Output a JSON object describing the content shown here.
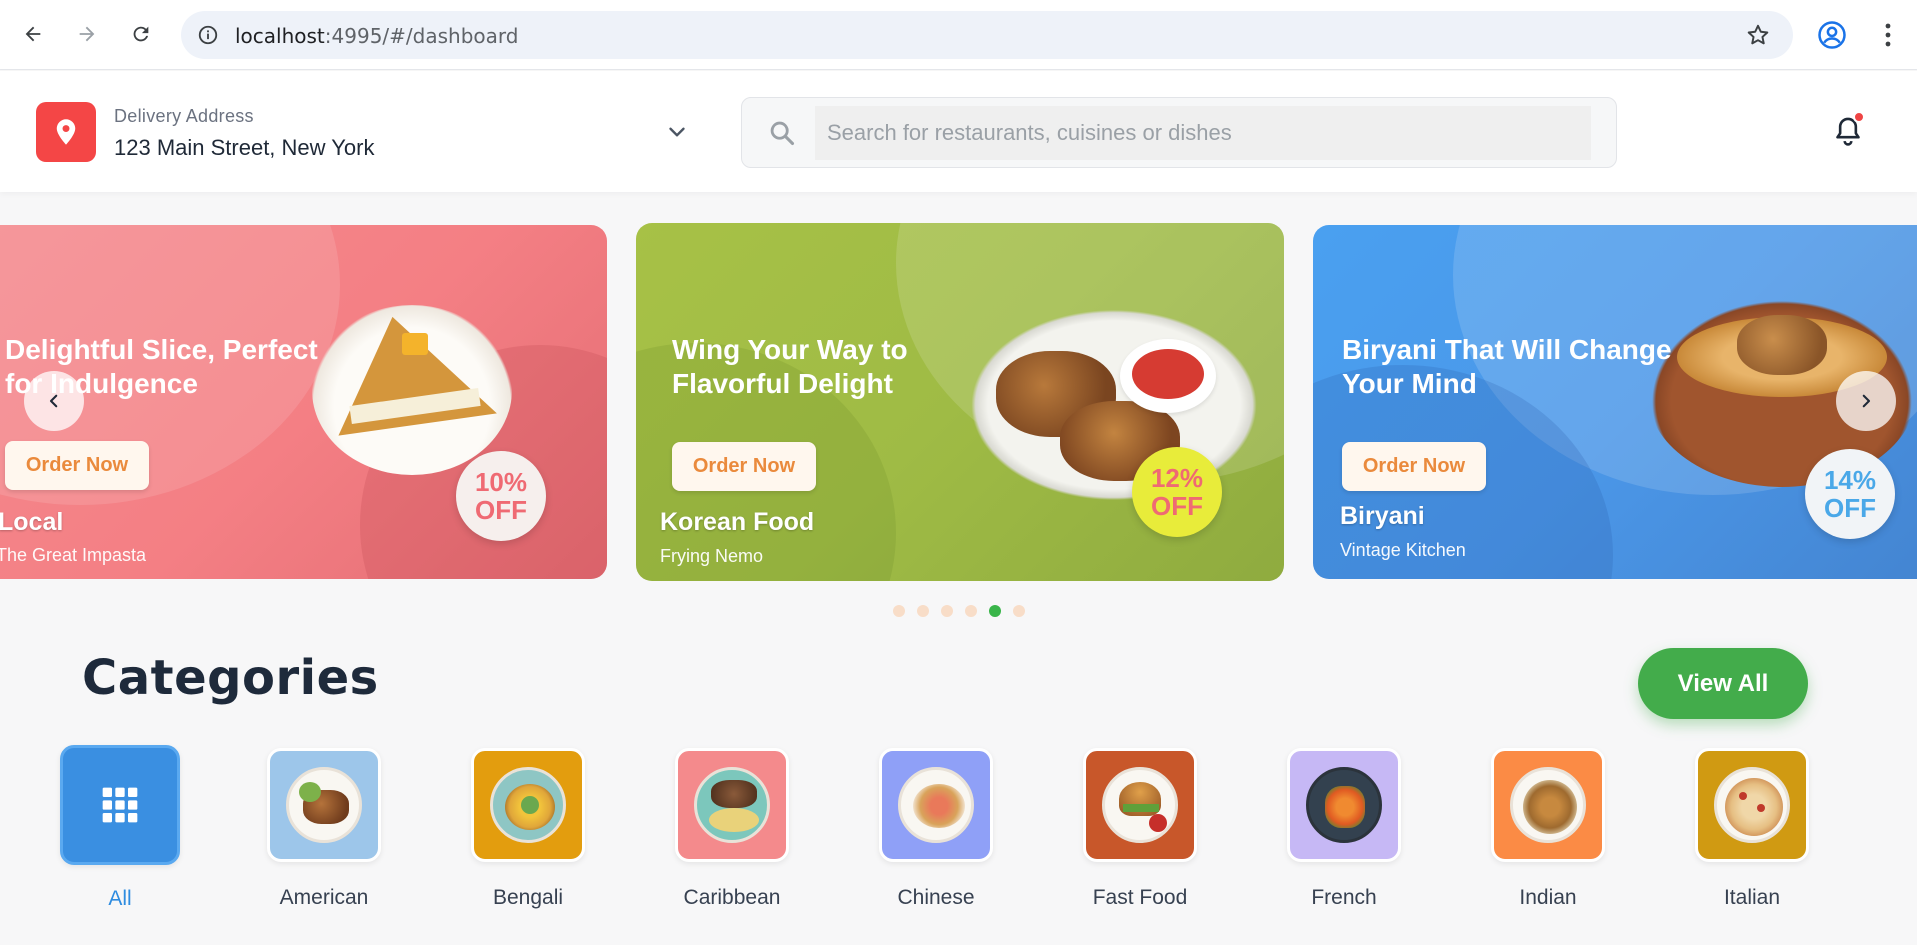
{
  "browser": {
    "url_host": "localhost",
    "url_rest": ":4995/#/dashboard"
  },
  "header": {
    "address_label": "Delivery Address",
    "address_value": "123 Main Street, New York",
    "search_placeholder": "Search for restaurants, cuisines or dishes"
  },
  "carousel": {
    "slides": [
      {
        "title": "Delightful Slice, Perfect for Indulgence",
        "button": "Order Now",
        "cuisine": "Local",
        "restaurant": "The Great Impasta",
        "discount_pct": "10%",
        "discount_word": "OFF"
      },
      {
        "title": "Wing Your Way to Flavorful Delight",
        "button": "Order Now",
        "cuisine": "Korean Food",
        "restaurant": "Frying Nemo",
        "discount_pct": "12%",
        "discount_word": "OFF"
      },
      {
        "title": "Biryani That Will Change Your Mind",
        "button": "Order Now",
        "cuisine": "Biryani",
        "restaurant": "Vintage Kitchen",
        "discount_pct": "14%",
        "discount_word": "OFF"
      }
    ],
    "dot_count": 6,
    "active_dot": 5
  },
  "categories": {
    "title": "Categories",
    "view_all": "View All",
    "items": [
      {
        "label": "All",
        "color": "#3a8fe1"
      },
      {
        "label": "American",
        "color": "#9dc6ea"
      },
      {
        "label": "Bengali",
        "color": "#e39d0e"
      },
      {
        "label": "Caribbean",
        "color": "#f48a8c"
      },
      {
        "label": "Chinese",
        "color": "#8fa0f7"
      },
      {
        "label": "Fast Food",
        "color": "#c8572a"
      },
      {
        "label": "French",
        "color": "#c6b8f5"
      },
      {
        "label": "Indian",
        "color": "#fb8b45"
      },
      {
        "label": "Italian",
        "color": "#d09a12"
      }
    ]
  },
  "colors": {
    "accent_red": "#f44646",
    "accent_green": "#43ac4b",
    "accent_blue": "#3a8fe1"
  }
}
